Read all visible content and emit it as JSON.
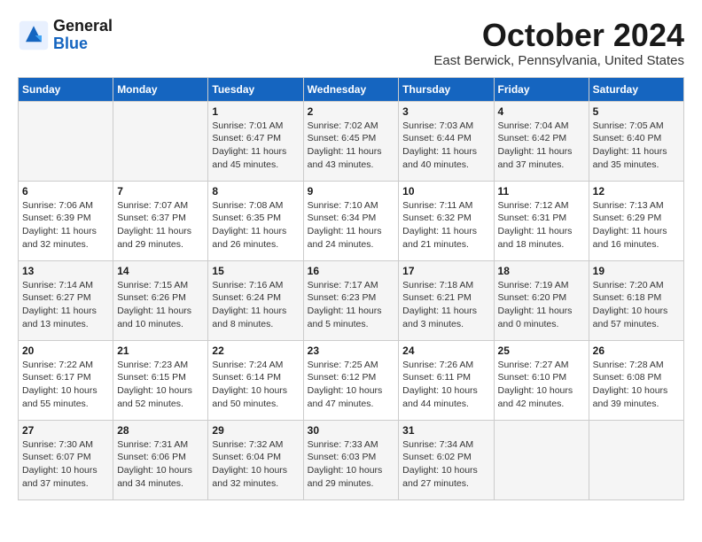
{
  "header": {
    "logo": {
      "line1": "General",
      "line2": "Blue"
    },
    "title": "October 2024",
    "location": "East Berwick, Pennsylvania, United States"
  },
  "weekdays": [
    "Sunday",
    "Monday",
    "Tuesday",
    "Wednesday",
    "Thursday",
    "Friday",
    "Saturday"
  ],
  "weeks": [
    [
      {
        "day": "",
        "info": ""
      },
      {
        "day": "",
        "info": ""
      },
      {
        "day": "1",
        "info": "Sunrise: 7:01 AM\nSunset: 6:47 PM\nDaylight: 11 hours and 45 minutes."
      },
      {
        "day": "2",
        "info": "Sunrise: 7:02 AM\nSunset: 6:45 PM\nDaylight: 11 hours and 43 minutes."
      },
      {
        "day": "3",
        "info": "Sunrise: 7:03 AM\nSunset: 6:44 PM\nDaylight: 11 hours and 40 minutes."
      },
      {
        "day": "4",
        "info": "Sunrise: 7:04 AM\nSunset: 6:42 PM\nDaylight: 11 hours and 37 minutes."
      },
      {
        "day": "5",
        "info": "Sunrise: 7:05 AM\nSunset: 6:40 PM\nDaylight: 11 hours and 35 minutes."
      }
    ],
    [
      {
        "day": "6",
        "info": "Sunrise: 7:06 AM\nSunset: 6:39 PM\nDaylight: 11 hours and 32 minutes."
      },
      {
        "day": "7",
        "info": "Sunrise: 7:07 AM\nSunset: 6:37 PM\nDaylight: 11 hours and 29 minutes."
      },
      {
        "day": "8",
        "info": "Sunrise: 7:08 AM\nSunset: 6:35 PM\nDaylight: 11 hours and 26 minutes."
      },
      {
        "day": "9",
        "info": "Sunrise: 7:10 AM\nSunset: 6:34 PM\nDaylight: 11 hours and 24 minutes."
      },
      {
        "day": "10",
        "info": "Sunrise: 7:11 AM\nSunset: 6:32 PM\nDaylight: 11 hours and 21 minutes."
      },
      {
        "day": "11",
        "info": "Sunrise: 7:12 AM\nSunset: 6:31 PM\nDaylight: 11 hours and 18 minutes."
      },
      {
        "day": "12",
        "info": "Sunrise: 7:13 AM\nSunset: 6:29 PM\nDaylight: 11 hours and 16 minutes."
      }
    ],
    [
      {
        "day": "13",
        "info": "Sunrise: 7:14 AM\nSunset: 6:27 PM\nDaylight: 11 hours and 13 minutes."
      },
      {
        "day": "14",
        "info": "Sunrise: 7:15 AM\nSunset: 6:26 PM\nDaylight: 11 hours and 10 minutes."
      },
      {
        "day": "15",
        "info": "Sunrise: 7:16 AM\nSunset: 6:24 PM\nDaylight: 11 hours and 8 minutes."
      },
      {
        "day": "16",
        "info": "Sunrise: 7:17 AM\nSunset: 6:23 PM\nDaylight: 11 hours and 5 minutes."
      },
      {
        "day": "17",
        "info": "Sunrise: 7:18 AM\nSunset: 6:21 PM\nDaylight: 11 hours and 3 minutes."
      },
      {
        "day": "18",
        "info": "Sunrise: 7:19 AM\nSunset: 6:20 PM\nDaylight: 11 hours and 0 minutes."
      },
      {
        "day": "19",
        "info": "Sunrise: 7:20 AM\nSunset: 6:18 PM\nDaylight: 10 hours and 57 minutes."
      }
    ],
    [
      {
        "day": "20",
        "info": "Sunrise: 7:22 AM\nSunset: 6:17 PM\nDaylight: 10 hours and 55 minutes."
      },
      {
        "day": "21",
        "info": "Sunrise: 7:23 AM\nSunset: 6:15 PM\nDaylight: 10 hours and 52 minutes."
      },
      {
        "day": "22",
        "info": "Sunrise: 7:24 AM\nSunset: 6:14 PM\nDaylight: 10 hours and 50 minutes."
      },
      {
        "day": "23",
        "info": "Sunrise: 7:25 AM\nSunset: 6:12 PM\nDaylight: 10 hours and 47 minutes."
      },
      {
        "day": "24",
        "info": "Sunrise: 7:26 AM\nSunset: 6:11 PM\nDaylight: 10 hours and 44 minutes."
      },
      {
        "day": "25",
        "info": "Sunrise: 7:27 AM\nSunset: 6:10 PM\nDaylight: 10 hours and 42 minutes."
      },
      {
        "day": "26",
        "info": "Sunrise: 7:28 AM\nSunset: 6:08 PM\nDaylight: 10 hours and 39 minutes."
      }
    ],
    [
      {
        "day": "27",
        "info": "Sunrise: 7:30 AM\nSunset: 6:07 PM\nDaylight: 10 hours and 37 minutes."
      },
      {
        "day": "28",
        "info": "Sunrise: 7:31 AM\nSunset: 6:06 PM\nDaylight: 10 hours and 34 minutes."
      },
      {
        "day": "29",
        "info": "Sunrise: 7:32 AM\nSunset: 6:04 PM\nDaylight: 10 hours and 32 minutes."
      },
      {
        "day": "30",
        "info": "Sunrise: 7:33 AM\nSunset: 6:03 PM\nDaylight: 10 hours and 29 minutes."
      },
      {
        "day": "31",
        "info": "Sunrise: 7:34 AM\nSunset: 6:02 PM\nDaylight: 10 hours and 27 minutes."
      },
      {
        "day": "",
        "info": ""
      },
      {
        "day": "",
        "info": ""
      }
    ]
  ]
}
